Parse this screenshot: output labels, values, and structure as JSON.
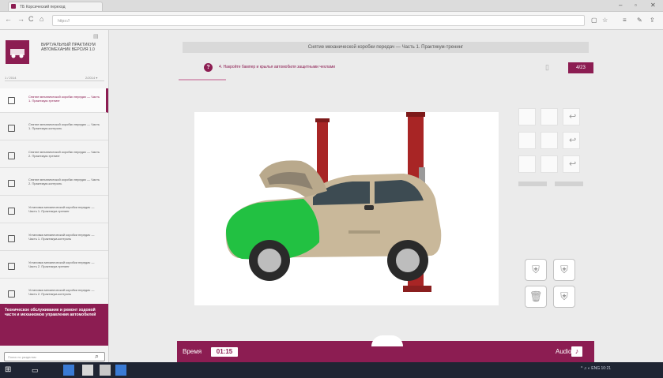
{
  "browser": {
    "tab_title": "ТБ Корсический переход",
    "url": "https://",
    "window_controls": [
      "–",
      "▫",
      "✕"
    ],
    "nav_buttons": [
      "←",
      "→",
      "C",
      "⌂"
    ]
  },
  "sidebar": {
    "app_name": "ВИРТУАЛЬНЫЙ ПРАКТИКУМ АВТОМЕХАНИК ВЕРСИЯ 1.0",
    "meta_left": "1 / 2014",
    "meta_right": "2/2014 ▾",
    "items": [
      {
        "label": "Снятие механической коробки передач — Часть 1. Практикум-тренинг",
        "active": true
      },
      {
        "label": "Снятие механической коробки передач — Часть 1. Практикум-контроль",
        "active": false
      },
      {
        "label": "Снятие механической коробки передач — Часть 2. Практикум-тренинг",
        "active": false
      },
      {
        "label": "Снятие механической коробки передач — Часть 2. Практикум-контроль",
        "active": false
      },
      {
        "label": "Установка механической коробки передач — Часть 1. Практикум-тренинг",
        "active": false
      },
      {
        "label": "Установка механической коробки передач — Часть 1. Практикум-контроль",
        "active": false
      },
      {
        "label": "Установка механической коробки передач — Часть 2. Практикум-тренинг",
        "active": false
      },
      {
        "label": "Установка механической коробки передач — Часть 2. Практикум-контроль",
        "active": false
      }
    ],
    "promo_text": "Техническое обслуживание и ремонт ходовой части и механизмов управления автомобилей",
    "search_placeholder": "Поиск по разделам"
  },
  "lesson": {
    "title": "Снятие механической коробки передач — Часть 1. Практикум-тренинг",
    "task_text": "4. Накройте бампер и крылья автомобиля защитными чехлами",
    "task_counter": "4/23",
    "help_icon": "?"
  },
  "footer": {
    "time_label": "Время",
    "time_value": "01:15",
    "audio_label": "Audio"
  },
  "colors": {
    "accent": "#8c1d52",
    "cover_green": "#22c142",
    "lift_red": "#a82525"
  },
  "taskbar": {
    "tray_text": "^ ♫ ◐ ENG 10:21"
  }
}
